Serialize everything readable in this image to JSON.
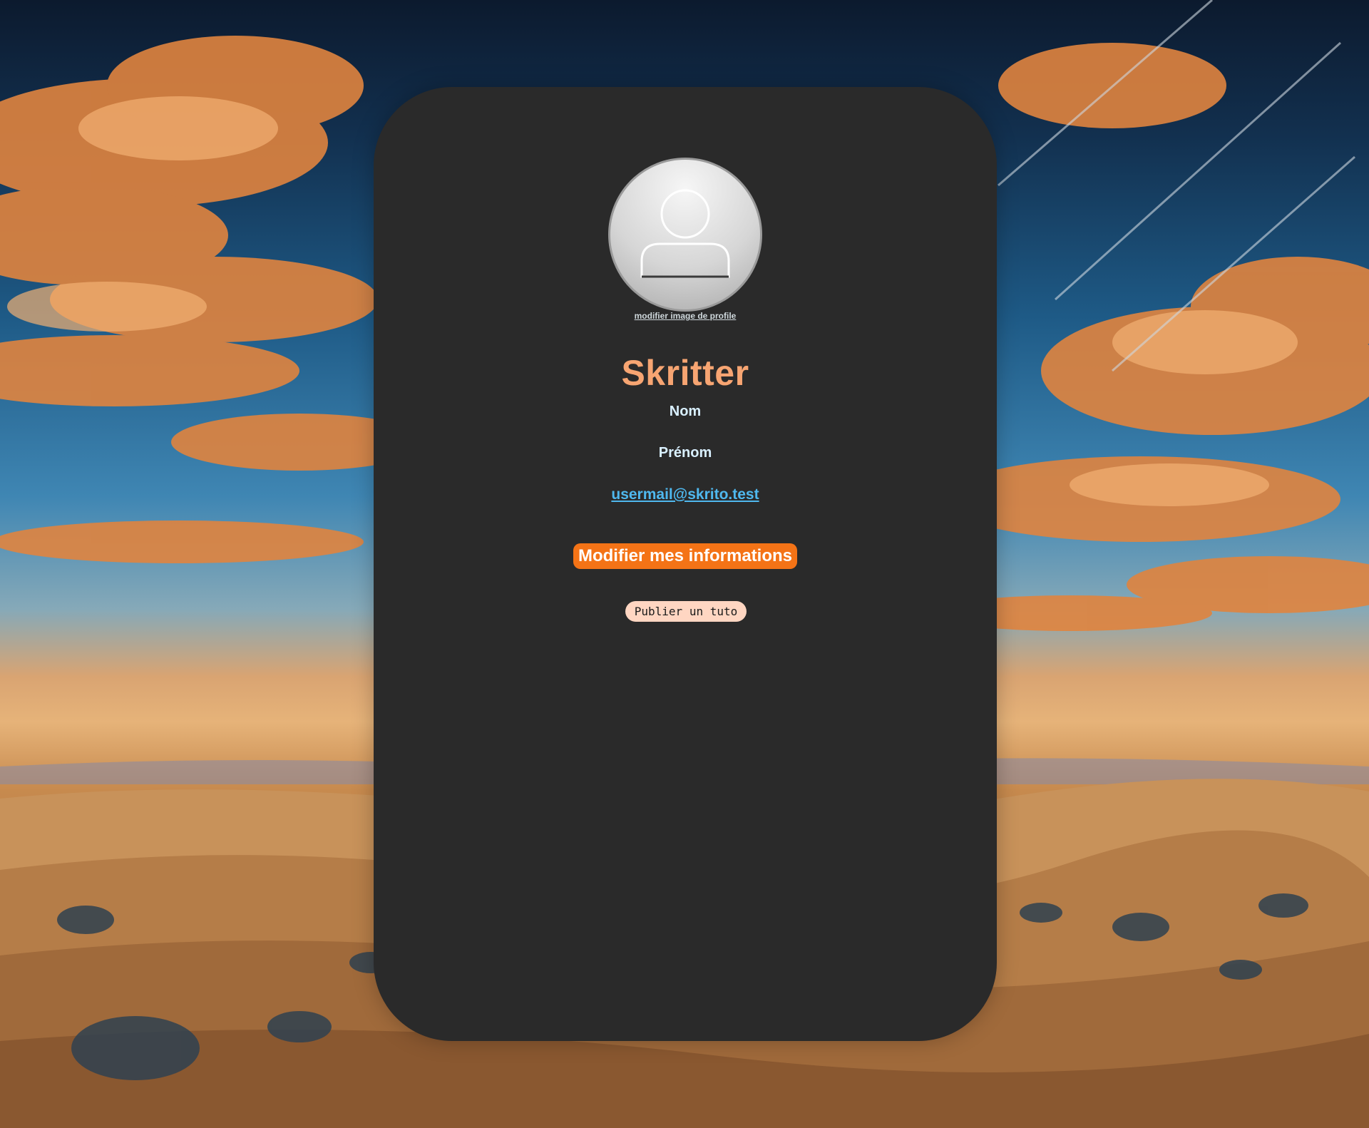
{
  "profile": {
    "avatar_icon": "user-silhouette-icon",
    "change_avatar_link": "modifier image de profile"
  },
  "app": {
    "title": "Skritter"
  },
  "user": {
    "last_name": "Nom",
    "first_name": "Prénom",
    "email": "usermail@skrito.test"
  },
  "actions": {
    "edit_label": "Modifier mes informations",
    "publish_label": "Publier un tuto"
  },
  "colors": {
    "card_background": "#2a2a2a",
    "title": "#f7a572",
    "field_text": "#d9f0ff",
    "email_link": "#4fb8ee",
    "edit_button": "#f47316",
    "publish_button": "#ffd6c2"
  }
}
